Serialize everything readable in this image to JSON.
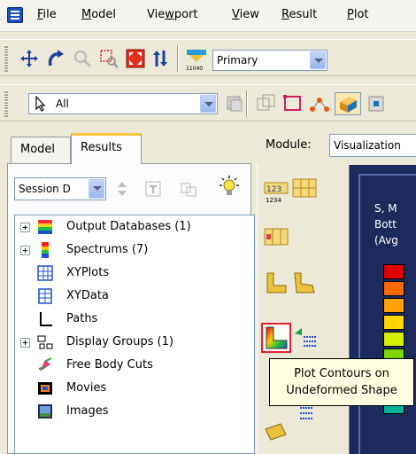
{
  "menubar": {
    "items": [
      {
        "pre": "",
        "u": "F",
        "post": "ile"
      },
      {
        "pre": "",
        "u": "M",
        "post": "odel"
      },
      {
        "pre": "Vie",
        "u": "w",
        "post": "port"
      },
      {
        "pre": "",
        "u": "V",
        "post": "iew"
      },
      {
        "pre": "",
        "u": "R",
        "post": "esult"
      },
      {
        "pre": "",
        "u": "P",
        "post": "lot"
      }
    ]
  },
  "toolbar": {
    "view_combo_value": "Primary",
    "selection_combo_value": "All",
    "view_icon_caption": "11040"
  },
  "tabs": {
    "model": "Model",
    "results": "Results"
  },
  "session": {
    "combo_value": "Session D"
  },
  "tree": {
    "items": [
      {
        "label": "Output Databases (1)",
        "expandable": true,
        "icon": "output-database-icon"
      },
      {
        "label": "Spectrums (7)",
        "expandable": true,
        "icon": "spectrum-icon"
      },
      {
        "label": "XYPlots",
        "expandable": false,
        "icon": "xyplot-icon"
      },
      {
        "label": "XYData",
        "expandable": false,
        "icon": "xydata-icon"
      },
      {
        "label": "Paths",
        "expandable": false,
        "icon": "path-icon"
      },
      {
        "label": "Display Groups (1)",
        "expandable": true,
        "icon": "display-group-icon"
      },
      {
        "label": "Free Body Cuts",
        "expandable": false,
        "icon": "free-body-cut-icon"
      },
      {
        "label": "Movies",
        "expandable": false,
        "icon": "movie-icon"
      },
      {
        "label": "Images",
        "expandable": false,
        "icon": "image-icon"
      }
    ]
  },
  "module": {
    "label": "Module:",
    "value": "Visualization"
  },
  "viewport": {
    "line1": "S, M",
    "line2": "Bott",
    "line3": "(Avg"
  },
  "tools": {
    "grid_numbers_top": "123",
    "grid_numbers_bottom": "1234"
  },
  "tooltip": {
    "line1": "Plot Contours on",
    "line2": "Undeformed Shape"
  },
  "colors": {
    "tab_highlight": "#ffc73c",
    "tooltip_bg": "#ffffe1",
    "selected_tool_border": "#e8222a",
    "viewport_bg": "#1c2a5c"
  },
  "legend": {
    "colors": [
      "#e10000",
      "#ff6a00",
      "#ffa000",
      "#ffd400",
      "#d4f000",
      "#7cd400",
      "#21c800",
      "#00c83c",
      "#00b49a"
    ]
  }
}
